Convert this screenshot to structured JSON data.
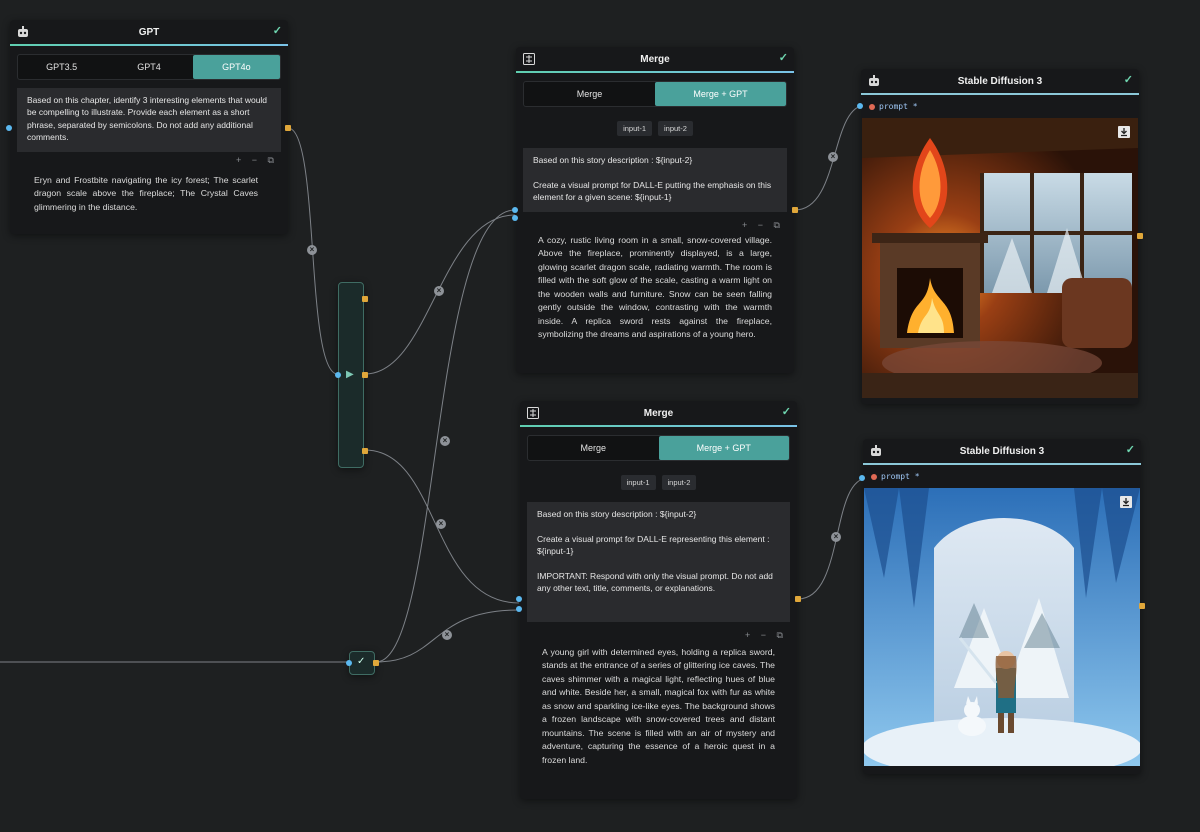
{
  "gpt_node": {
    "title": "GPT",
    "tabs": [
      "GPT3.5",
      "GPT4",
      "GPT4o"
    ],
    "active_tab": "GPT4o",
    "prompt": "Based on this chapter, identify 3 interesting elements that would be compelling to illustrate. Provide each element as a short phrase, separated by semicolons. Do not add any additional comments.",
    "result": "Eryn and Frostbite navigating the icy forest; The scarlet dragon scale above the fireplace; The Crystal Caves glimmering in the distance."
  },
  "merge_top": {
    "title": "Merge",
    "tabs": [
      "Merge",
      "Merge + GPT"
    ],
    "active_tab": "Merge + GPT",
    "chips": [
      "input-1",
      "input-2"
    ],
    "prompt": "Based on this story description : ${input-2}\n\nCreate a visual prompt for DALL-E putting the emphasis on this element for a given scene: ${input-1}",
    "result": "A cozy, rustic living room in a small, snow-covered village. Above the fireplace, prominently displayed, is a large, glowing scarlet dragon scale, radiating warmth. The room is filled with the soft glow of the scale, casting a warm light on the wooden walls and furniture. Snow can be seen falling gently outside the window, contrasting with the warmth inside. A replica sword rests against the fireplace, symbolizing the dreams and aspirations of a young hero."
  },
  "merge_bottom": {
    "title": "Merge",
    "tabs": [
      "Merge",
      "Merge + GPT"
    ],
    "active_tab": "Merge + GPT",
    "chips": [
      "input-1",
      "input-2"
    ],
    "prompt": "Based on this story description : ${input-2}\n\nCreate a visual prompt for DALL-E representing this element : ${input-1}\n\nIMPORTANT: Respond with only the visual prompt. Do not add any other text, title, comments, or explanations.",
    "result": "A young girl with determined eyes, holding a replica sword, stands at the entrance of a series of glittering ice caves. The caves shimmer with a magical light, reflecting hues of blue and white. Beside her, a small, magical fox with fur as white as snow and sparkling ice-like eyes. The background shows a frozen landscape with snow-covered trees and distant mountains. The scene is filled with an air of mystery and adventure, capturing the essence of a heroic quest in a frozen land."
  },
  "sd_top": {
    "title": "Stable Diffusion 3",
    "prompt_label": "prompt *"
  },
  "sd_bottom": {
    "title": "Stable Diffusion 3",
    "prompt_label": "prompt *"
  },
  "mini_tools": "+ − ⧉",
  "colors": {
    "accent": "#4aa19b",
    "canvas": "#1e2021",
    "node": "#17181a"
  }
}
